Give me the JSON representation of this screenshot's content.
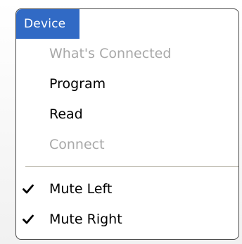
{
  "menu": {
    "title": "Device",
    "items": [
      {
        "label": "What's Connected",
        "enabled": false
      },
      {
        "label": "Program",
        "enabled": true
      },
      {
        "label": "Read",
        "enabled": true
      },
      {
        "label": "Connect",
        "enabled": false
      }
    ],
    "toggle_items": [
      {
        "label": "Mute Left",
        "checked": true,
        "check_icon": "checkmark-icon"
      },
      {
        "label": "Mute Right",
        "checked": true,
        "check_icon": "checkmark-icon"
      }
    ]
  },
  "colors": {
    "header_bg": "#316ac5",
    "disabled_text": "#a8a8a8",
    "border": "#4a4a4a"
  }
}
